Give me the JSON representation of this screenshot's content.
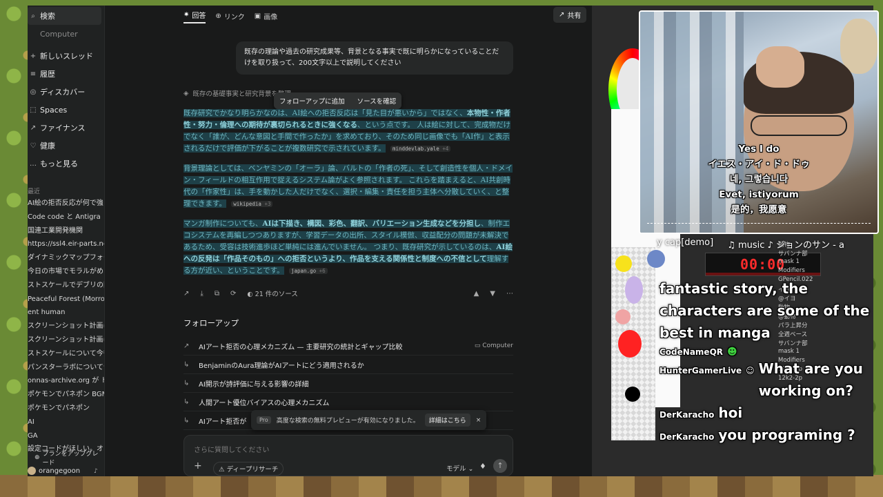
{
  "sidebar": {
    "top": [
      {
        "icon": "search-icon",
        "glyph": "⌕",
        "label": "検索",
        "active": true
      },
      {
        "icon": "computer-icon",
        "glyph": "",
        "label": "Computer",
        "muted": true
      }
    ],
    "nav": [
      {
        "icon": "plus-icon",
        "glyph": "+",
        "label": "新しいスレッド"
      },
      {
        "icon": "history-icon",
        "glyph": "≡",
        "label": "履歴"
      },
      {
        "icon": "discover-icon",
        "glyph": "◎",
        "label": "ディスカバー"
      },
      {
        "icon": "spaces-icon",
        "glyph": "⬚",
        "label": "Spaces"
      },
      {
        "icon": "finance-icon",
        "glyph": "↗",
        "label": "ファイナンス"
      },
      {
        "icon": "health-icon",
        "glyph": "♡",
        "label": "健康"
      },
      {
        "icon": "more-icon",
        "glyph": "…",
        "label": "もっと見る"
      }
    ],
    "history_label": "最近",
    "history": [
      "AI絵の拒否反応が何で強い",
      "Code code と Antigra",
      "国連工業開発機関",
      "https://ssl4.eir-parts.net/",
      "ダイナミックマップフォーム",
      "今日の市場でモラルがめっちゃ",
      "ストスケールでデブリの回収",
      "Peaceful Forest (Morroc,F",
      "ent human",
      "スクリーンショット計画について 詳し",
      "スクリーンショット計画について 詳し",
      "ストスケールについて今後の",
      "パンスターラボについて今後の",
      "onnas-archive.org が ドメ",
      "ポケモンでパネポン BGM",
      "ポケモンでパネポン",
      "AI",
      "GA",
      "設定コードがほしい。オオサカ"
    ],
    "upgrade": "プランをアップグレード",
    "user": "orangegoon"
  },
  "header": {
    "tabs": [
      {
        "icon": "answer-icon",
        "glyph": "✷",
        "label": "回答",
        "active": true
      },
      {
        "icon": "link-icon",
        "glyph": "⊕",
        "label": "リンク"
      },
      {
        "icon": "image-icon",
        "glyph": "▣",
        "label": "画像"
      }
    ],
    "share": "共有"
  },
  "question": "既存の理論や過去の研究成果等、背景となる事実で既に明らかになっていることだけを取り扱って、200文字以上で説明してください",
  "steps_text": "既存の基礎事実と研究背景を整理",
  "popover": {
    "add": "フォローアップに追加",
    "check": "ソースを確認"
  },
  "answer": {
    "p1": {
      "a": "既存研究でかなり明らかなのは、AI絵への拒否反応は「見た目が悪いから」ではなく、",
      "b": "本物性・作者性・努力・倫理への期待が裏切られるときに強くなる",
      "c": "、という点です。 人は絵に対して、完成物だけでなく「誰が、どんな意図と手間で作ったか」を求めており、そのため同じ画像でも「AI作」と表示されるだけで評価が下がることが複数研究で示されています。",
      "cite": "minddevlab.yale",
      "cite_more": "+4"
    },
    "p2": {
      "a": "背景理論としては、ベンヤミンの「オーラ」論、バルトの「作者の死」、そして創造性を個人・ドメイン・フィールドの相互作用で捉えるシステム論がよく参照されます。 これらを踏まえると、AI共創時代の「作家性」は、手を動かした人だけでなく、選択・編集・責任を担う主体へ分散していく、と整理できます。",
      "cite": "wikipedia",
      "cite_more": "+3"
    },
    "p3": {
      "a": "マンガ制作についても、",
      "b": "AIは下描き、構図、彩色、翻訳、バリエーション生成などを分担し",
      "c": "、制作エコシステムを再編しつつありますが、学習データの出所、スタイル模倣、収益配分の問題が未解決であるため、受容は技術進歩ほど単純には進んでいません。 つまり、既存研究が示しているのは、",
      "d": "AI絵への反発は「作品そのもの」への拒否というより、作品を支える関係性と制度への不信として",
      "e": "理解する方が近い、ということです。",
      "cite": "japan.go",
      "cite_more": "+6"
    }
  },
  "actions": {
    "sources": "21 件のソース"
  },
  "followup": {
    "title": "フォローアップ",
    "items": [
      {
        "label": "AIアート拒否の心理メカニズム — 主要研究の統計とギャップ比較",
        "tag": "Computer"
      },
      {
        "label": "BenjaminのAura理論がAIアートにどう適用されるか",
        "tag": ""
      },
      {
        "label": "AI開示が詩評価に与える影響の詳細",
        "tag": ""
      },
      {
        "label": "人間アート優位バイアスの心理メカニズム",
        "tag": ""
      },
      {
        "label": "AIアート拒否が",
        "tag": ""
      }
    ]
  },
  "toast": {
    "pro": "Pro",
    "text": "高度な検索の無料プレビューが有効になりました。",
    "more": "詳細はこちら",
    "close": "×"
  },
  "input": {
    "placeholder": "さらに質問してください",
    "deep": "ディープリサーチ",
    "model": "モデル"
  },
  "paint": {
    "timer": "00:00",
    "layers": [
      "動物",
      "サバンナ部",
      "mask 1",
      "Modifiers",
      "GPencil.022",
      "イヨ",
      "@イヨ",
      "動物",
      "@動物",
      "パラ上昇分",
      "全週ベース",
      "サバンナ部",
      "mask 1",
      "Modifiers",
      "12k2-2p",
      "12k2-2p"
    ]
  },
  "stream_strip": {
    "cap": "y cap[demo]",
    "music": "♫ music ♪ ジョンのサン - a"
  },
  "subtitles": [
    "Yes I do",
    "イエス・アイ・ド・ドゥ",
    "네, 그렇습니다",
    "Evet, istiyorum",
    "是的，我愿意"
  ],
  "chat": {
    "message1": "fantastic story, the characters are some of the best in manga",
    "messages": [
      {
        "user": "CodeNameQR",
        "text": ""
      },
      {
        "user": "HunterGamerLive",
        "text": "What are you working on?"
      },
      {
        "user": "DerKaracho",
        "text": "hoi"
      },
      {
        "user": "DerKaracho",
        "text": "you programing ?"
      }
    ]
  }
}
